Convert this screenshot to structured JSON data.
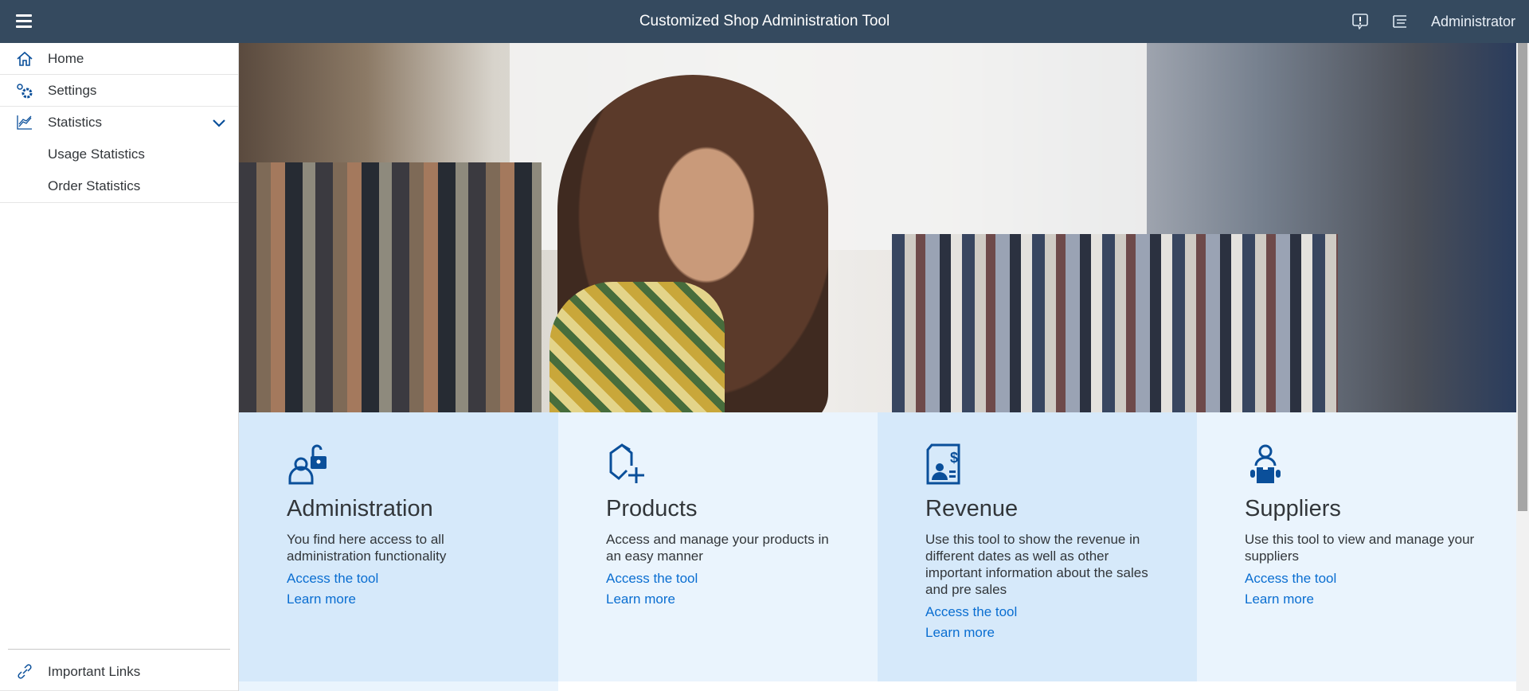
{
  "header": {
    "title": "Customized Shop Administration Tool",
    "user": "Administrator",
    "icons": [
      "menu-icon",
      "feedback-icon",
      "notifications-icon"
    ]
  },
  "sidebar": {
    "items": [
      {
        "label": "Home",
        "icon": "home-icon"
      },
      {
        "label": "Settings",
        "icon": "settings-icon"
      },
      {
        "label": "Statistics",
        "icon": "line-chart-icon",
        "expanded": true,
        "children": [
          {
            "label": "Usage Statistics"
          },
          {
            "label": "Order Statistics"
          }
        ]
      }
    ],
    "footer": {
      "label": "Important Links",
      "icon": "link-icon"
    }
  },
  "cards": [
    {
      "title": "Administration",
      "description": "You find here access to all administration functionality",
      "access": "Access the tool",
      "learn": "Learn more",
      "icon": "user-unlock-icon"
    },
    {
      "title": "Products",
      "description": "Access and manage your products in an easy manner",
      "access": "Access the tool",
      "learn": "Learn more",
      "icon": "add-product-icon"
    },
    {
      "title": "Revenue",
      "description": "Use this tool to show the revenue in different dates as well as other important information about the sales and pre sales",
      "access": "Access the tool",
      "learn": "Learn more",
      "icon": "revenue-document-icon"
    },
    {
      "title": "Suppliers",
      "description": "Use this tool to view and manage your suppliers",
      "access": "Access the tool",
      "learn": "Learn more",
      "icon": "supplier-icon"
    }
  ],
  "colors": {
    "shell": "#354a5f",
    "accent": "#0a6ed1",
    "card_dark": "#d6e9fa",
    "card_light": "#eaf4fd"
  }
}
